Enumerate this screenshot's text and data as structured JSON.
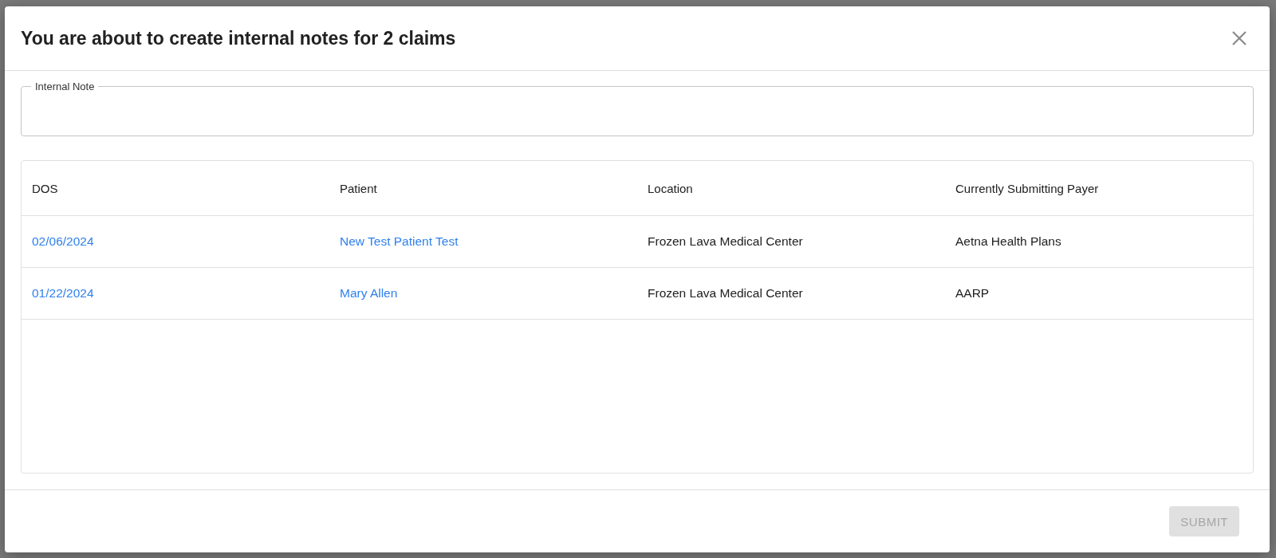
{
  "dialog": {
    "title": "You are about to create internal notes for 2 claims",
    "note_field": {
      "label": "Internal Note"
    },
    "table": {
      "columns": [
        "DOS",
        "Patient",
        "Location",
        "Currently Submitting Payer"
      ],
      "rows": [
        {
          "dos": "02/06/2024",
          "patient": "New Test Patient Test",
          "location": "Frozen Lava Medical Center",
          "payer": "Aetna Health Plans"
        },
        {
          "dos": "01/22/2024",
          "patient": "Mary Allen",
          "location": "Frozen Lava Medical Center",
          "payer": "AARP"
        }
      ]
    },
    "submit": {
      "label": "SUBMIT",
      "disabled": true
    }
  }
}
